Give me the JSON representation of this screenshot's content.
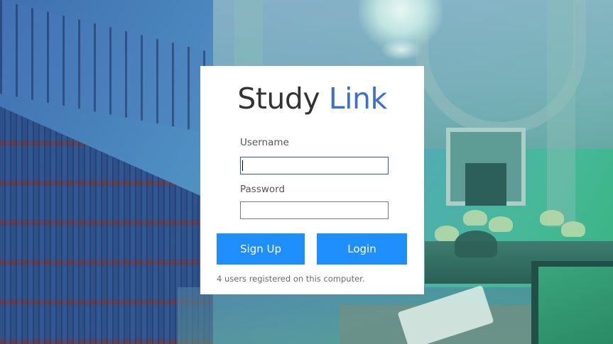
{
  "app": {
    "title_part1": "Study",
    "title_part2": "Link",
    "title_colors": {
      "part1": "#333333",
      "part2": "#3d6fd1"
    }
  },
  "form": {
    "username_label": "Username",
    "username_value": "",
    "password_label": "Password",
    "password_value": ""
  },
  "buttons": {
    "signup_label": "Sign Up",
    "login_label": "Login",
    "color": "#1e8ffc"
  },
  "status": {
    "registered_text": "4 users registered on this computer."
  }
}
